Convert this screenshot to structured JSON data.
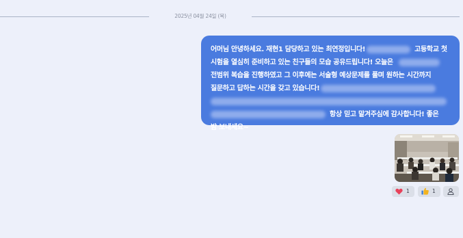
{
  "date_separator": {
    "text": "2025년 04월 24일 (목)"
  },
  "message": {
    "line1_start": "어머님 안녕하세요. 재현1 담당하고 있는 최연정입니다!",
    "line1_end": "고등학교 첫",
    "line2_start": "시험을 열심히 준비하고 있는 친구들의 모습 공유드립니다! 오늘은",
    "line3": "전범위 복습을 진행하였고 그 이후에는 서술형 예상문제를 풀며 원하는 시간까지",
    "line4_start": "질문하고 답하는 시간을 갖고 있습니다!",
    "line6_end": "항상 믿고 맡겨주심에 감사합니다! 좋은",
    "line7": "밤 보내세요~"
  },
  "reactions": {
    "heart_icon": "heart-icon",
    "heart_count": "1",
    "thumbs_icon": "thumbs-up-icon",
    "thumbs_count": "1",
    "person_icon": "person-icon",
    "heart_color": "#e8415a",
    "thumbs_color": "#f2b320"
  },
  "colors": {
    "background": "#edf0fa",
    "bubble": "#4a7bdf",
    "separator_line": "#aab3c6"
  }
}
